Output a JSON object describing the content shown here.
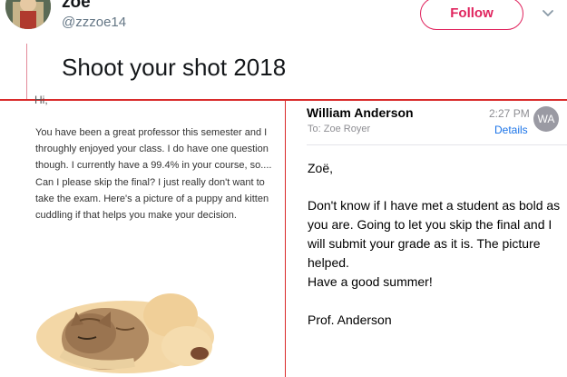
{
  "tweet": {
    "display_name": "zoe",
    "handle": "@zzzoe14",
    "follow_label": "Follow",
    "text": "Shoot your shot 2018"
  },
  "left_email": {
    "greeting": "Hi,",
    "body": "You have been a great professor this semester and I throughly enjoyed your class. I do have one question though. I currently have a 99.4% in your course, so.... Can I please skip the final? I just really don't want to take the exam. Here's a picture of a puppy and kitten cuddling if that helps you make your decision."
  },
  "right_email": {
    "sender": "William Anderson",
    "time": "2:27 PM",
    "to_label": "To:",
    "to_name": "Zoe Royer",
    "details_label": "Details",
    "avatar_initials": "WA",
    "salutation": "Zoë,",
    "paragraph": "Don't know if I have met a student as bold as you are. Going to let you skip the final and I will submit your grade as it is. The picture helped.",
    "closing_line": "Have a good summer!",
    "signature": "Prof. Anderson"
  },
  "colors": {
    "follow_accent": "#e0245e",
    "annotation_red": "#d92b2b",
    "link_blue": "#1a73e8"
  }
}
